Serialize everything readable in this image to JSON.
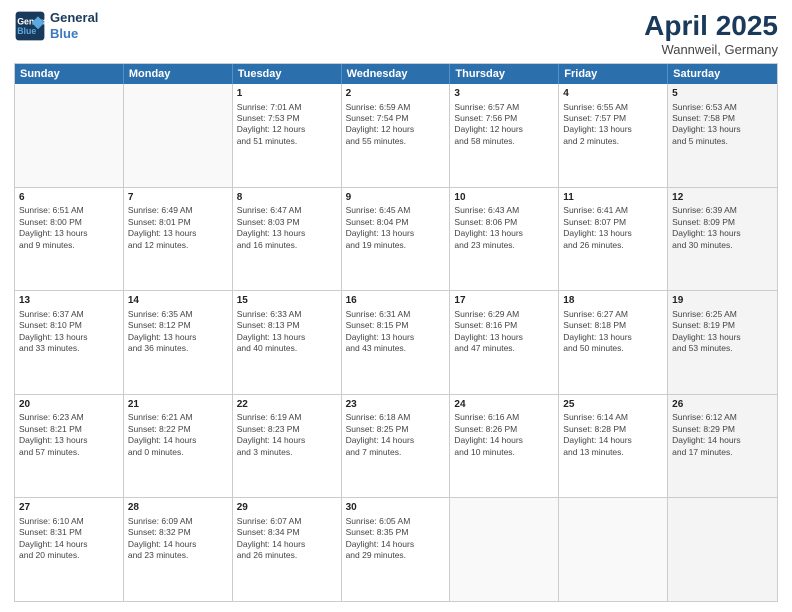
{
  "header": {
    "logo_line1": "General",
    "logo_line2": "Blue",
    "month": "April 2025",
    "location": "Wannweil, Germany"
  },
  "days_of_week": [
    "Sunday",
    "Monday",
    "Tuesday",
    "Wednesday",
    "Thursday",
    "Friday",
    "Saturday"
  ],
  "weeks": [
    [
      {
        "day": "",
        "info": "",
        "empty": true
      },
      {
        "day": "",
        "info": "",
        "empty": true
      },
      {
        "day": "1",
        "info": "Sunrise: 7:01 AM\nSunset: 7:53 PM\nDaylight: 12 hours\nand 51 minutes."
      },
      {
        "day": "2",
        "info": "Sunrise: 6:59 AM\nSunset: 7:54 PM\nDaylight: 12 hours\nand 55 minutes."
      },
      {
        "day": "3",
        "info": "Sunrise: 6:57 AM\nSunset: 7:56 PM\nDaylight: 12 hours\nand 58 minutes."
      },
      {
        "day": "4",
        "info": "Sunrise: 6:55 AM\nSunset: 7:57 PM\nDaylight: 13 hours\nand 2 minutes."
      },
      {
        "day": "5",
        "info": "Sunrise: 6:53 AM\nSunset: 7:58 PM\nDaylight: 13 hours\nand 5 minutes.",
        "shaded": true
      }
    ],
    [
      {
        "day": "6",
        "info": "Sunrise: 6:51 AM\nSunset: 8:00 PM\nDaylight: 13 hours\nand 9 minutes."
      },
      {
        "day": "7",
        "info": "Sunrise: 6:49 AM\nSunset: 8:01 PM\nDaylight: 13 hours\nand 12 minutes."
      },
      {
        "day": "8",
        "info": "Sunrise: 6:47 AM\nSunset: 8:03 PM\nDaylight: 13 hours\nand 16 minutes."
      },
      {
        "day": "9",
        "info": "Sunrise: 6:45 AM\nSunset: 8:04 PM\nDaylight: 13 hours\nand 19 minutes."
      },
      {
        "day": "10",
        "info": "Sunrise: 6:43 AM\nSunset: 8:06 PM\nDaylight: 13 hours\nand 23 minutes."
      },
      {
        "day": "11",
        "info": "Sunrise: 6:41 AM\nSunset: 8:07 PM\nDaylight: 13 hours\nand 26 minutes."
      },
      {
        "day": "12",
        "info": "Sunrise: 6:39 AM\nSunset: 8:09 PM\nDaylight: 13 hours\nand 30 minutes.",
        "shaded": true
      }
    ],
    [
      {
        "day": "13",
        "info": "Sunrise: 6:37 AM\nSunset: 8:10 PM\nDaylight: 13 hours\nand 33 minutes."
      },
      {
        "day": "14",
        "info": "Sunrise: 6:35 AM\nSunset: 8:12 PM\nDaylight: 13 hours\nand 36 minutes."
      },
      {
        "day": "15",
        "info": "Sunrise: 6:33 AM\nSunset: 8:13 PM\nDaylight: 13 hours\nand 40 minutes."
      },
      {
        "day": "16",
        "info": "Sunrise: 6:31 AM\nSunset: 8:15 PM\nDaylight: 13 hours\nand 43 minutes."
      },
      {
        "day": "17",
        "info": "Sunrise: 6:29 AM\nSunset: 8:16 PM\nDaylight: 13 hours\nand 47 minutes."
      },
      {
        "day": "18",
        "info": "Sunrise: 6:27 AM\nSunset: 8:18 PM\nDaylight: 13 hours\nand 50 minutes."
      },
      {
        "day": "19",
        "info": "Sunrise: 6:25 AM\nSunset: 8:19 PM\nDaylight: 13 hours\nand 53 minutes.",
        "shaded": true
      }
    ],
    [
      {
        "day": "20",
        "info": "Sunrise: 6:23 AM\nSunset: 8:21 PM\nDaylight: 13 hours\nand 57 minutes."
      },
      {
        "day": "21",
        "info": "Sunrise: 6:21 AM\nSunset: 8:22 PM\nDaylight: 14 hours\nand 0 minutes."
      },
      {
        "day": "22",
        "info": "Sunrise: 6:19 AM\nSunset: 8:23 PM\nDaylight: 14 hours\nand 3 minutes."
      },
      {
        "day": "23",
        "info": "Sunrise: 6:18 AM\nSunset: 8:25 PM\nDaylight: 14 hours\nand 7 minutes."
      },
      {
        "day": "24",
        "info": "Sunrise: 6:16 AM\nSunset: 8:26 PM\nDaylight: 14 hours\nand 10 minutes."
      },
      {
        "day": "25",
        "info": "Sunrise: 6:14 AM\nSunset: 8:28 PM\nDaylight: 14 hours\nand 13 minutes."
      },
      {
        "day": "26",
        "info": "Sunrise: 6:12 AM\nSunset: 8:29 PM\nDaylight: 14 hours\nand 17 minutes.",
        "shaded": true
      }
    ],
    [
      {
        "day": "27",
        "info": "Sunrise: 6:10 AM\nSunset: 8:31 PM\nDaylight: 14 hours\nand 20 minutes."
      },
      {
        "day": "28",
        "info": "Sunrise: 6:09 AM\nSunset: 8:32 PM\nDaylight: 14 hours\nand 23 minutes."
      },
      {
        "day": "29",
        "info": "Sunrise: 6:07 AM\nSunset: 8:34 PM\nDaylight: 14 hours\nand 26 minutes."
      },
      {
        "day": "30",
        "info": "Sunrise: 6:05 AM\nSunset: 8:35 PM\nDaylight: 14 hours\nand 29 minutes."
      },
      {
        "day": "",
        "info": "",
        "empty": true
      },
      {
        "day": "",
        "info": "",
        "empty": true
      },
      {
        "day": "",
        "info": "",
        "empty": true,
        "shaded": true
      }
    ]
  ]
}
